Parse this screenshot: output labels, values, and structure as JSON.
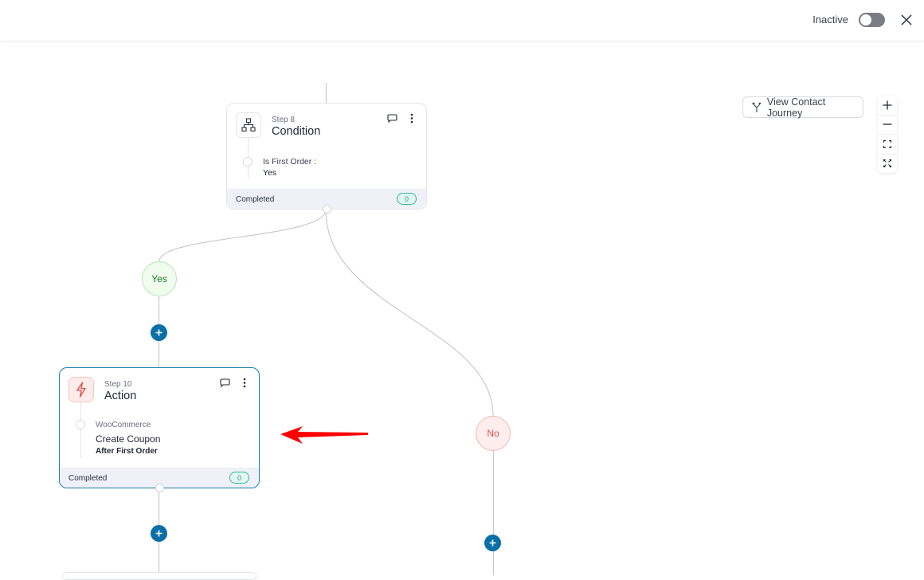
{
  "header": {
    "status_label": "Inactive",
    "toggle_on": false,
    "close_icon": "close-icon"
  },
  "toolbar": {
    "view_journey_label": "View Contact Journey",
    "view_journey_icon": "branch-icon",
    "zoom_controls": [
      {
        "name": "zoom-in",
        "icon": "plus-icon"
      },
      {
        "name": "zoom-out",
        "icon": "minus-icon"
      },
      {
        "name": "fit-view",
        "icon": "fit-icon"
      },
      {
        "name": "fullscreen",
        "icon": "expand-icon"
      }
    ]
  },
  "nodes": {
    "condition": {
      "step": "Step 8",
      "title": "Condition",
      "icon": "hierarchy-icon",
      "rule_label": "Is First Order :",
      "rule_value": "Yes",
      "footer_label": "Completed",
      "count": "0"
    },
    "action": {
      "step": "Step 10",
      "title": "Action",
      "icon": "lightning-icon",
      "integration": "WooCommerce",
      "action_name": "Create Coupon",
      "action_detail": "After First Order",
      "footer_label": "Completed",
      "count": "0"
    }
  },
  "branches": {
    "yes_label": "Yes",
    "no_label": "No"
  },
  "colors": {
    "accent": "#0a6fa6",
    "selected_border": "#1a7fb0",
    "yes_green": "#1c7a1c",
    "no_red": "#d9534f",
    "count_teal": "#33b59e",
    "annotation_arrow": "#ff0000"
  }
}
